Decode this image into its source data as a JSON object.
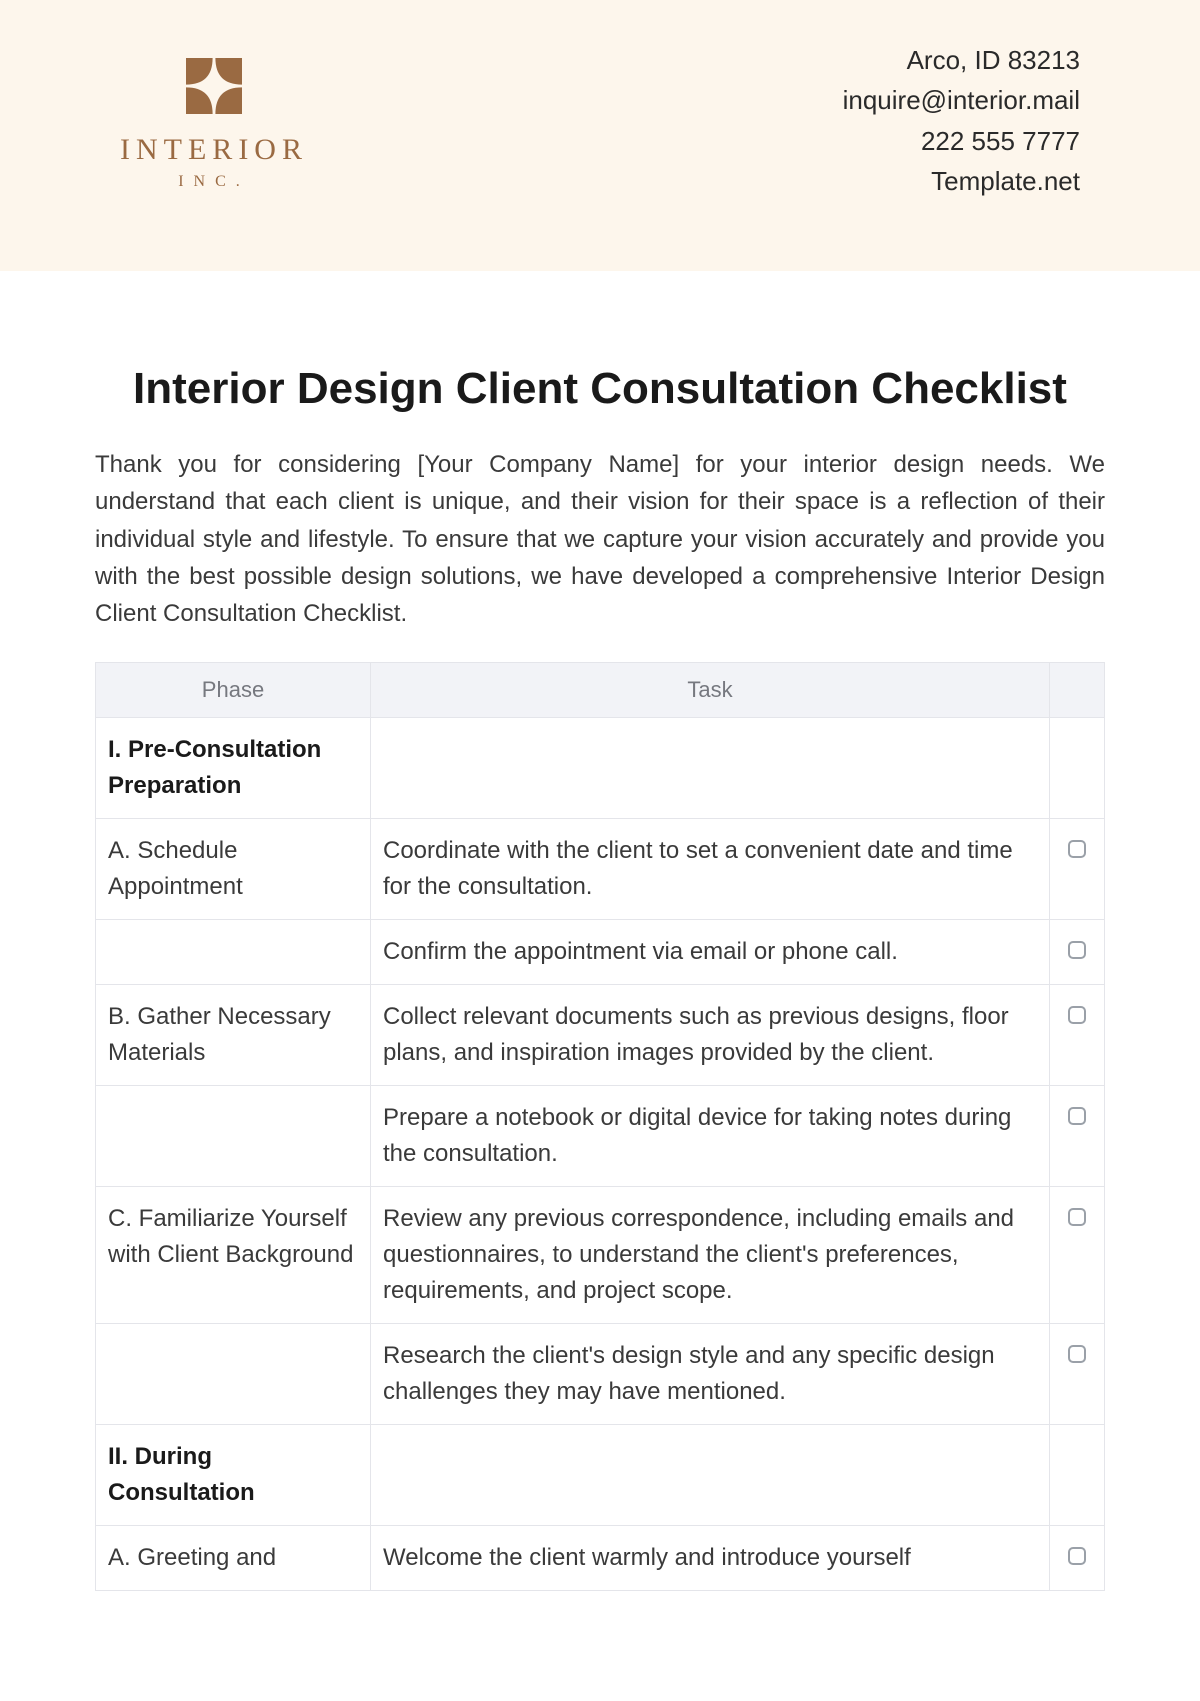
{
  "header": {
    "logo_word": "INTERIOR",
    "logo_sub": "INC.",
    "contact": {
      "address": "Arco, ID 83213",
      "email": "inquire@interior.mail",
      "phone": "222 555 7777",
      "site": "Template.net"
    }
  },
  "title": "Interior Design Client Consultation Checklist",
  "intro": "Thank you for considering [Your Company Name] for your interior design needs. We understand that each client is unique, and their vision for their space is a reflection of their individual style and lifestyle. To ensure that we capture your vision accurately and provide you with the best possible design solutions, we have developed a comprehensive Interior Design Client Consultation Checklist.",
  "columns": {
    "phase": "Phase",
    "task": "Task"
  },
  "rows": [
    {
      "phase": "I. Pre-Consultation Preparation",
      "task": "",
      "section": true,
      "check": false
    },
    {
      "phase": "A. Schedule Appointment",
      "task": "Coordinate with the client to set a convenient date and time for the consultation.",
      "section": false,
      "check": true
    },
    {
      "phase": "",
      "task": "Confirm the appointment via email or phone call.",
      "section": false,
      "check": true
    },
    {
      "phase": "B. Gather Necessary Materials",
      "task": "Collect relevant documents such as previous designs, floor plans, and inspiration images provided by the client.",
      "section": false,
      "check": true
    },
    {
      "phase": "",
      "task": "Prepare a notebook or digital device for taking notes during the consultation.",
      "section": false,
      "check": true
    },
    {
      "phase": "C. Familiarize Yourself with Client Background",
      "task": "Review any previous correspondence, including emails and questionnaires, to understand the client's preferences, requirements, and project scope.",
      "section": false,
      "check": true
    },
    {
      "phase": "",
      "task": "Research the client's design style and any specific design challenges they may have mentioned.",
      "section": false,
      "check": true
    },
    {
      "phase": "II. During Consultation",
      "task": "",
      "section": true,
      "check": false
    },
    {
      "phase": "A. Greeting and",
      "task": "Welcome the client warmly and introduce yourself",
      "section": false,
      "check": true
    }
  ]
}
